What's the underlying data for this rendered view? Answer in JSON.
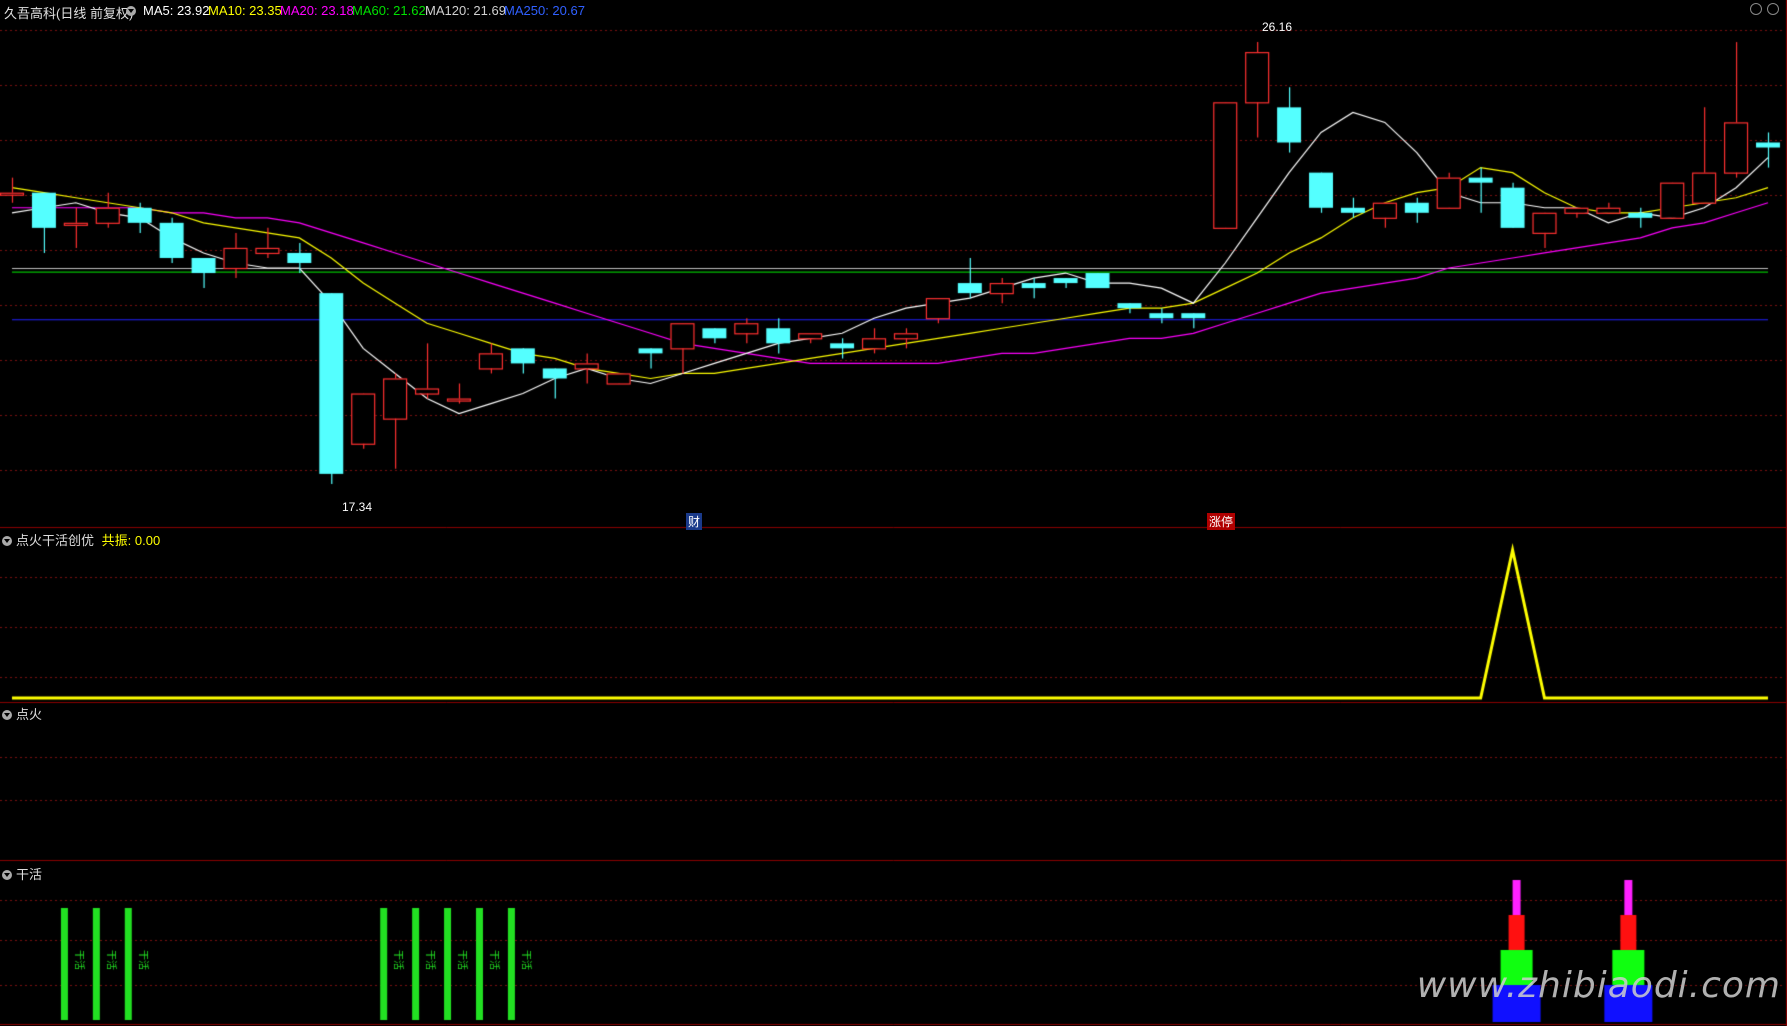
{
  "header": {
    "stock": "久吾高科(日线 前复权)",
    "ma5": "MA5: 23.92",
    "ma10": "MA10: 23.35",
    "ma20": "MA20: 23.18",
    "ma60": "MA60: 21.62",
    "ma120": "MA120: 21.69",
    "ma250": "MA250: 20.67"
  },
  "colors": {
    "ma5": "#ffffff",
    "ma10": "#ffff00",
    "ma20": "#ff00ff",
    "ma60": "#00c000",
    "ma120": "#bfbfbf",
    "ma250": "#2020ff",
    "up": "#ff3030",
    "down": "#54ffff",
    "grid": "#8b0000"
  },
  "annotations": {
    "high": "26.16",
    "low": "17.34",
    "cai": "财",
    "zhangting": "涨停"
  },
  "pane2": {
    "title": "点火干活创优",
    "label": "共振:",
    "value": "0.00"
  },
  "pane3": {
    "title": "点火"
  },
  "pane4": {
    "title": "干活",
    "bar_text": "干活"
  },
  "watermark": "www.zhibiaodi.com",
  "chart_data": {
    "type": "candlestick",
    "candles": [
      [
        23.2,
        23.2,
        23.5,
        23.0
      ],
      [
        23.2,
        22.5,
        23.2,
        22.0
      ],
      [
        22.6,
        22.6,
        22.9,
        22.1
      ],
      [
        22.6,
        22.9,
        23.2,
        22.5
      ],
      [
        22.9,
        22.6,
        23.0,
        22.4
      ],
      [
        22.6,
        21.9,
        22.7,
        21.8
      ],
      [
        21.9,
        21.6,
        21.9,
        21.3
      ],
      [
        21.7,
        22.1,
        22.4,
        21.5
      ],
      [
        22.0,
        22.1,
        22.5,
        21.9
      ],
      [
        22.0,
        21.8,
        22.2,
        21.6
      ],
      [
        21.2,
        17.6,
        21.2,
        17.4
      ],
      [
        18.2,
        19.2,
        19.2,
        18.1
      ],
      [
        18.7,
        19.5,
        19.6,
        17.7
      ],
      [
        19.2,
        19.3,
        20.2,
        19.1
      ],
      [
        19.1,
        19.1,
        19.4,
        19.0
      ],
      [
        19.7,
        20.0,
        20.2,
        19.6
      ],
      [
        20.1,
        19.8,
        20.1,
        19.6
      ],
      [
        19.7,
        19.5,
        19.7,
        19.1
      ],
      [
        19.7,
        19.8,
        20.0,
        19.4
      ],
      [
        19.4,
        19.6,
        19.6,
        19.4
      ],
      [
        20.1,
        20.0,
        20.1,
        19.7
      ],
      [
        20.1,
        20.6,
        20.6,
        19.6
      ],
      [
        20.5,
        20.3,
        20.5,
        20.2
      ],
      [
        20.4,
        20.6,
        20.7,
        20.2
      ],
      [
        20.5,
        20.2,
        20.7,
        20.0
      ],
      [
        20.3,
        20.4,
        20.4,
        20.2
      ],
      [
        20.2,
        20.1,
        20.3,
        19.9
      ],
      [
        20.1,
        20.3,
        20.5,
        20.0
      ],
      [
        20.3,
        20.4,
        20.5,
        20.1
      ],
      [
        20.7,
        21.1,
        21.1,
        20.6
      ],
      [
        21.4,
        21.2,
        21.9,
        21.1
      ],
      [
        21.2,
        21.4,
        21.5,
        21.0
      ],
      [
        21.4,
        21.3,
        21.5,
        21.1
      ],
      [
        21.5,
        21.4,
        21.5,
        21.3
      ],
      [
        21.6,
        21.3,
        21.6,
        21.3
      ],
      [
        21.0,
        20.9,
        21.0,
        20.8
      ],
      [
        20.8,
        20.7,
        20.9,
        20.6
      ],
      [
        20.8,
        20.7,
        20.8,
        20.5
      ],
      [
        22.5,
        25.0,
        25.0,
        22.5
      ],
      [
        25.0,
        26.0,
        26.2,
        24.3
      ],
      [
        24.9,
        24.2,
        25.3,
        24.0
      ],
      [
        23.6,
        22.9,
        23.6,
        22.8
      ],
      [
        22.9,
        22.8,
        23.1,
        22.7
      ],
      [
        22.7,
        23.0,
        23.0,
        22.5
      ],
      [
        23.0,
        22.8,
        23.1,
        22.6
      ],
      [
        22.9,
        23.5,
        23.6,
        22.9
      ],
      [
        23.5,
        23.4,
        23.7,
        22.8
      ],
      [
        23.3,
        22.5,
        23.4,
        22.5
      ],
      [
        22.4,
        22.8,
        22.8,
        22.1
      ],
      [
        22.8,
        22.9,
        22.9,
        22.7
      ],
      [
        22.8,
        22.9,
        23.0,
        22.8
      ],
      [
        22.8,
        22.7,
        22.9,
        22.5
      ],
      [
        22.7,
        23.4,
        23.4,
        22.7
      ],
      [
        23.0,
        23.6,
        24.9,
        23.0
      ],
      [
        23.6,
        24.6,
        26.2,
        23.5
      ],
      [
        24.2,
        24.1,
        24.4,
        23.7
      ]
    ],
    "ma5": [
      22.8,
      22.9,
      23.0,
      22.8,
      22.7,
      22.3,
      22.0,
      21.8,
      21.7,
      21.7,
      21.0,
      20.1,
      19.6,
      19.1,
      18.8,
      19.0,
      19.2,
      19.5,
      19.7,
      19.5,
      19.4,
      19.6,
      19.8,
      20.0,
      20.2,
      20.3,
      20.4,
      20.7,
      20.9,
      21.0,
      21.1,
      21.3,
      21.5,
      21.6,
      21.4,
      21.4,
      21.3,
      21.0,
      21.8,
      22.7,
      23.6,
      24.4,
      24.8,
      24.6,
      24.0,
      23.2,
      23.0,
      23.0,
      22.9,
      22.9,
      22.6,
      22.8,
      22.7,
      22.9,
      23.3,
      23.9
    ],
    "ma10": [
      23.3,
      23.2,
      23.1,
      23.0,
      22.9,
      22.8,
      22.6,
      22.5,
      22.4,
      22.3,
      21.9,
      21.4,
      21.0,
      20.6,
      20.4,
      20.2,
      20.0,
      19.9,
      19.7,
      19.6,
      19.5,
      19.6,
      19.6,
      19.7,
      19.8,
      19.9,
      20.0,
      20.1,
      20.2,
      20.3,
      20.4,
      20.5,
      20.6,
      20.7,
      20.8,
      20.9,
      20.9,
      21.0,
      21.3,
      21.6,
      22.0,
      22.3,
      22.7,
      23.0,
      23.2,
      23.3,
      23.7,
      23.6,
      23.2,
      22.9,
      22.8,
      22.8,
      22.9,
      23.0,
      23.1,
      23.3
    ],
    "ma20": [
      22.9,
      22.9,
      22.9,
      22.9,
      22.9,
      22.8,
      22.8,
      22.7,
      22.7,
      22.6,
      22.4,
      22.2,
      22.0,
      21.8,
      21.6,
      21.4,
      21.2,
      21.0,
      20.8,
      20.6,
      20.4,
      20.2,
      20.1,
      20.0,
      19.9,
      19.8,
      19.8,
      19.8,
      19.8,
      19.8,
      19.9,
      20.0,
      20.0,
      20.1,
      20.2,
      20.3,
      20.3,
      20.4,
      20.6,
      20.8,
      21.0,
      21.2,
      21.3,
      21.4,
      21.5,
      21.7,
      21.8,
      21.9,
      22.0,
      22.1,
      22.2,
      22.3,
      22.5,
      22.6,
      22.8,
      23.0
    ],
    "ma60": 21.62,
    "ma120": 21.69,
    "ma250": 20.67,
    "ylim": [
      17.0,
      26.6
    ]
  },
  "pane2_series": {
    "line": [
      0,
      0,
      0,
      0,
      0,
      0,
      0,
      0,
      0,
      0,
      0,
      0,
      0,
      0,
      0,
      0,
      0,
      0,
      0,
      0,
      0,
      0,
      0,
      0,
      0,
      0,
      0,
      0,
      0,
      0,
      0,
      0,
      0,
      0,
      0,
      0,
      0,
      0,
      0,
      0,
      0,
      0,
      0,
      0,
      0,
      0,
      0,
      1,
      0,
      0,
      0,
      0,
      0,
      0,
      0,
      0
    ]
  }
}
